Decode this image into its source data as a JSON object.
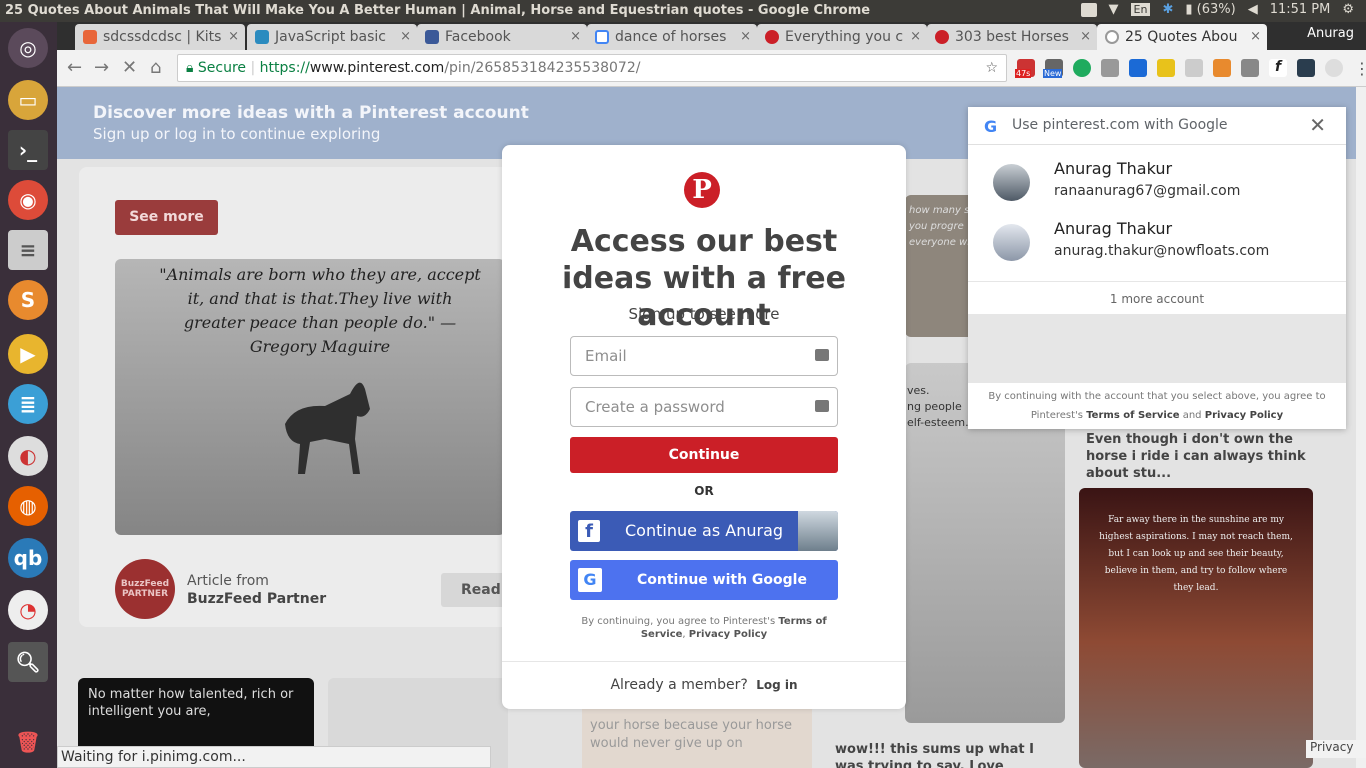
{
  "system": {
    "window_title": "25 Quotes About Animals That Will Make You A Better Human | Animal, Horse and Equestrian quotes - Google Chrome",
    "battery": "(63%)",
    "time": "11:51 PM",
    "lang": "En"
  },
  "tabs": [
    {
      "label": "sdcssdcdsc | Kits",
      "close": "×"
    },
    {
      "label": "JavaScript basic",
      "close": "×"
    },
    {
      "label": "Facebook",
      "close": "×"
    },
    {
      "label": "dance of horses",
      "close": "×"
    },
    {
      "label": "Everything you c",
      "close": "×"
    },
    {
      "label": "303 best Horses",
      "close": "×"
    },
    {
      "label": "25 Quotes Abou",
      "close": "×"
    }
  ],
  "profile_name": "Anurag",
  "toolbar": {
    "secure_label": "Secure",
    "url_scheme": "https://",
    "url_host": "www.pinterest.com",
    "url_path": "/pin/265853184235538072/",
    "ext_badge_1": "47s",
    "ext_badge_2": "New"
  },
  "banner": {
    "title": "Discover more ideas with a Pinterest account",
    "subtitle": "Sign up or log in to continue exploring"
  },
  "pin": {
    "see_more": "See more",
    "quote": "\"Animals are born who they are, accept it, and that is that.They live with greater peace than people do.\" — Gregory Maguire",
    "article_from": "Article from",
    "article_source": "BuzzFeed Partner",
    "buzzfeed_logo": "BuzzFeed PARTNER",
    "read": "Read"
  },
  "side_tiles": {
    "dark_quote": "No matter how talented, rich or intelligent you are,",
    "horse_text": "your horse because your horse would never give up on",
    "caption_1": "Even though i don't own the horse i ride i can always think about stu...",
    "caption_2": "wow!!! this sums up what I was trying to say. Love this pin. =)",
    "poster_text": "Far away there in the sunshine are my highest aspirations. I may not reach them, but I can look up and see their beauty, believe in them, and try to follow where they lead.",
    "fragment_1": "how many s",
    "fragment_2": "you progre",
    "fragment_3": "everyone who",
    "fragment_4": "ves.",
    "fragment_5": "ng people",
    "fragment_6": "elf-esteem."
  },
  "modal": {
    "title": "Access our best ideas with a free account",
    "subtitle": "Sign up to see more",
    "email_placeholder": "Email",
    "password_placeholder": "Create a password",
    "continue": "Continue",
    "or": "OR",
    "facebook": "Continue as Anurag",
    "google": "Continue with Google",
    "terms_prefix": "By continuing, you agree to Pinterest's",
    "terms_link": "Terms of Service",
    "privacy_link": "Privacy Policy",
    "already": "Already a member?",
    "login": "Log in"
  },
  "google_popup": {
    "title": "Use pinterest.com with Google",
    "accounts": [
      {
        "name": "Anurag Thakur",
        "email": "ranaanurag67@gmail.com"
      },
      {
        "name": "Anurag Thakur",
        "email": "anurag.thakur@nowfloats.com"
      }
    ],
    "more": "1 more account",
    "footer_prefix": "By continuing with the account that you select above, you agree to Pinterest's",
    "footer_tos": "Terms of Service",
    "footer_and": "and",
    "footer_privacy": "Privacy Policy"
  },
  "status": "Waiting for i.pinimg.com...",
  "privacy_tag": "Privacy",
  "colors": {
    "pinterest_red": "#cb1f27",
    "facebook_blue": "#3b5bb6",
    "google_blue": "#4d72ef"
  }
}
